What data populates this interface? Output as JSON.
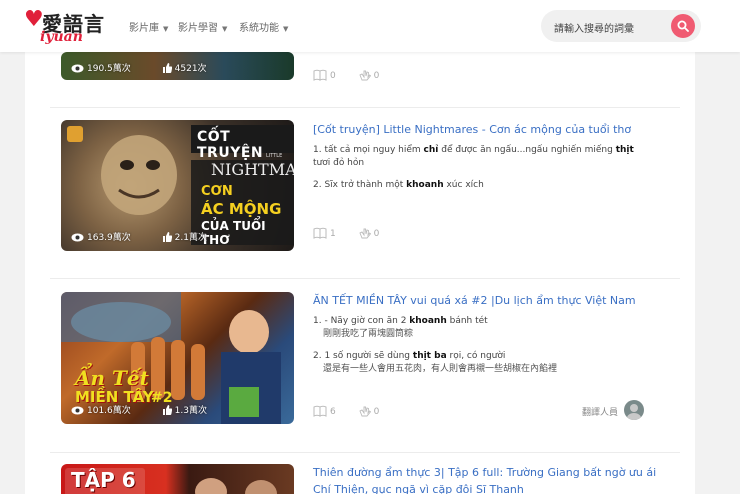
{
  "header": {
    "logo_text": "愛語言",
    "logo_sub": "iyuan",
    "nav": [
      {
        "label": "影片庫"
      },
      {
        "label": "影片學習"
      },
      {
        "label": "系統功能"
      }
    ],
    "search_placeholder": "請輸入搜尋的詞彙"
  },
  "videos": [
    {
      "views": "190.5萬次",
      "likes": "4521次",
      "meta_count1": "0",
      "meta_count2": "0"
    },
    {
      "thumb_text": {
        "line1": "CỐT TRUYỆN",
        "line2": "LITTLE",
        "line3": "NIGHTMARES",
        "line4": "CƠN",
        "line5": "ÁC MỘNG",
        "line6": "CỦA TUỔI THƠ"
      },
      "views": "163.9萬次",
      "likes": "2.1萬次",
      "title": "[Cốt truyện] Little Nightmares - Cơn ác mộng của tuổi thơ",
      "lines": [
        {
          "num": "1.",
          "pre": "tất cả mọi nguy hiểm ",
          "b1": "chỉ",
          "mid": " để được ăn ngấu...ngấu nghiến miếng ",
          "b2": "thịt",
          "post": " tươi đỏ hỏn",
          "zh": ""
        },
        {
          "num": "2.",
          "pre": "Sĩx trở thành một ",
          "b1": "khoanh",
          "mid": " xúc xích",
          "b2": "",
          "post": "",
          "zh": ""
        }
      ],
      "meta_count1": "1",
      "meta_count2": "0"
    },
    {
      "thumb_text": {
        "line1": "Ẩn Tết",
        "line2": "MIỀN TÂY",
        "line3": "#2"
      },
      "views": "101.6萬次",
      "likes": "1.3萬次",
      "title": "ĂN TẾT MIỀN TÂY vui quá xá #2 |Du lịch ẩm thực Việt Nam",
      "lines": [
        {
          "num": "1.",
          "pre": "- Nãy giờ con ăn 2 ",
          "b1": "khoanh",
          "mid": " bánh tét",
          "b2": "",
          "post": "",
          "zh": "剛剛我吃了兩塊圓筒粽"
        },
        {
          "num": "2.",
          "pre": "1 số người sẽ dùng ",
          "b1": "thịt ba",
          "mid": " rọi, có người",
          "b2": "",
          "post": "",
          "zh": "還是有一些人會用五花肉，有人則會再襯一些胡椒在內餡裡"
        }
      ],
      "meta_count1": "6",
      "meta_count2": "0",
      "translator_label": "翻譯人員"
    },
    {
      "thumb_text": {
        "line1": "TẬP 6"
      },
      "title": "Thiên đường ẩm thực 3| Tập 6 full: Trường Giang bất ngờ ưu ái Chí Thiện, gục ngã vì cặp đôi Sĩ Thanh"
    }
  ]
}
